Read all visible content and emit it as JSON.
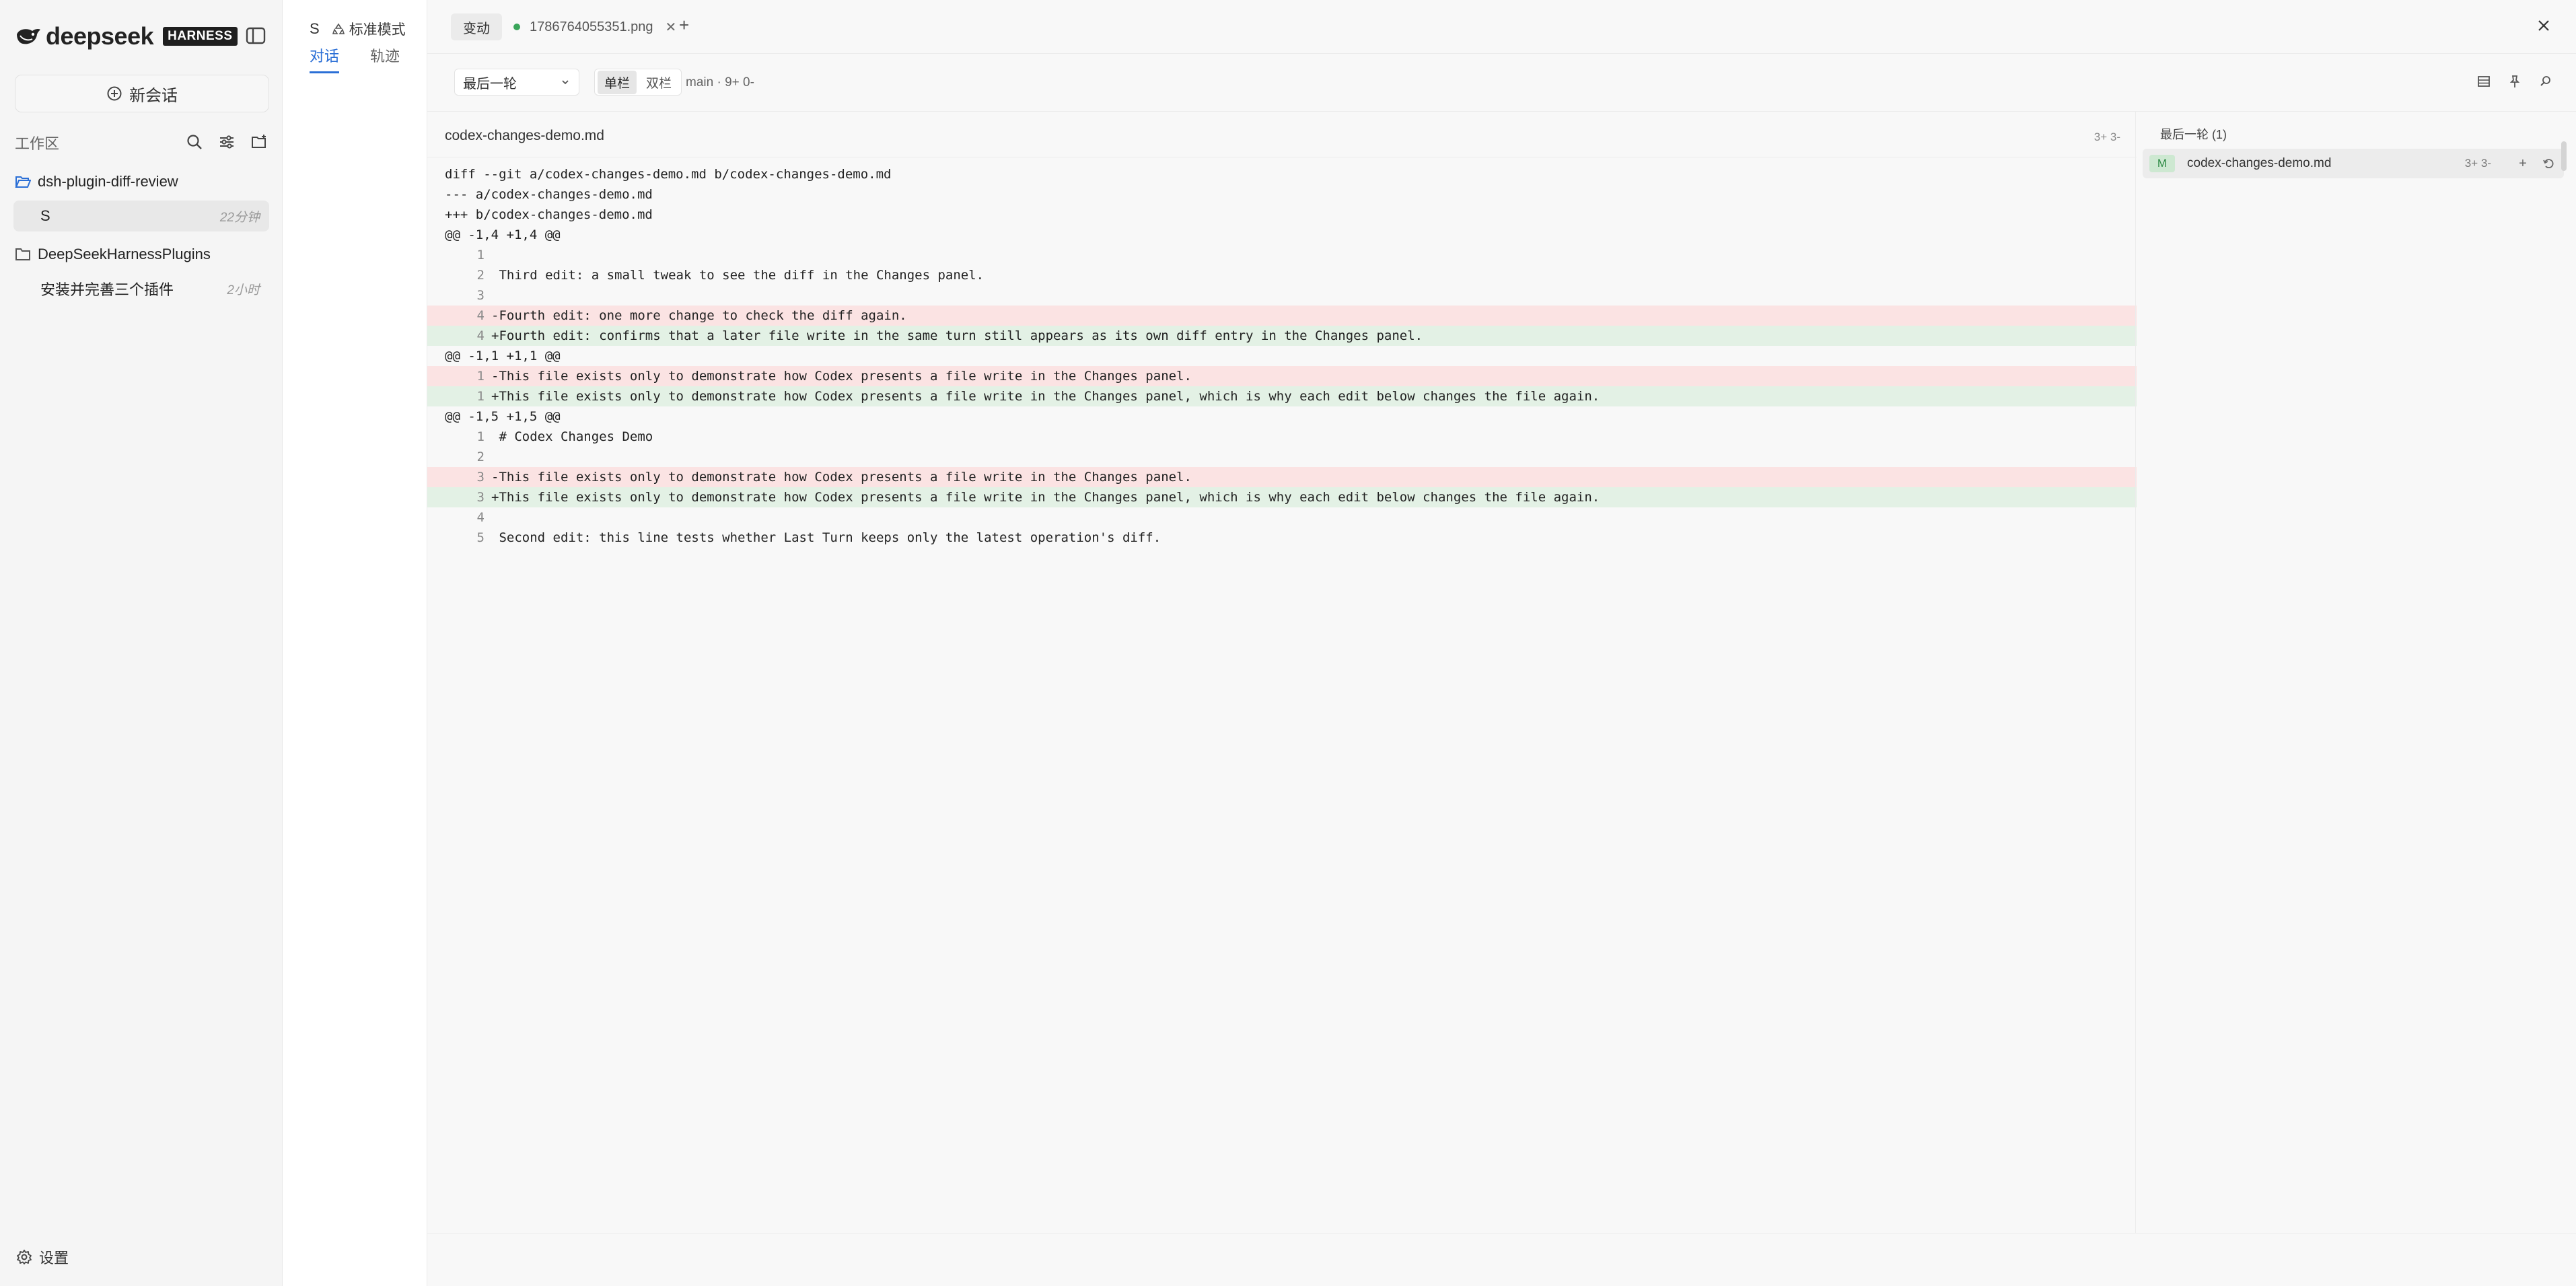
{
  "sidebar": {
    "brand": "deepseek",
    "badge": "HARNESS",
    "new_chat": "新会话",
    "workspace_label": "工作区",
    "projects": [
      {
        "name": "dsh-plugin-diff-review",
        "sessions": [
          {
            "name": "S",
            "time": "22分钟",
            "active": true
          }
        ]
      },
      {
        "name": "DeepSeekHarnessPlugins",
        "sessions": [
          {
            "name": "安装并完善三个插件",
            "time": "2小时",
            "active": false
          }
        ]
      }
    ],
    "settings": "设置"
  },
  "conversation": {
    "name": "S",
    "mode": "标准模式",
    "tabs": [
      "对话",
      "轨迹"
    ]
  },
  "main": {
    "tabs": {
      "changes": "变动",
      "file": "1786764055351.png"
    },
    "turn_select": "最后一轮",
    "view": {
      "unified": "单栏",
      "split": "双栏"
    },
    "branch": "main · 9+ 0-",
    "diff_file": "codex-changes-demo.md",
    "diff_stats": "3+ 3-",
    "diff_lines": [
      {
        "t": "meta",
        "n": "",
        "c": "diff --git a/codex-changes-demo.md b/codex-changes-demo.md"
      },
      {
        "t": "meta",
        "n": "",
        "c": "--- a/codex-changes-demo.md"
      },
      {
        "t": "meta",
        "n": "",
        "c": "+++ b/codex-changes-demo.md"
      },
      {
        "t": "meta",
        "n": "",
        "c": "@@ -1,4 +1,4 @@"
      },
      {
        "t": "ctx",
        "n": "1",
        "c": " "
      },
      {
        "t": "ctx",
        "n": "2",
        "c": " Third edit: a small tweak to see the diff in the Changes panel."
      },
      {
        "t": "ctx",
        "n": "3",
        "c": " "
      },
      {
        "t": "del",
        "n": "4",
        "c": "-Fourth edit: one more change to check the diff again."
      },
      {
        "t": "add",
        "n": "4",
        "c": "+Fourth edit: confirms that a later file write in the same turn still appears as its own diff entry in the Changes panel."
      },
      {
        "t": "meta",
        "n": "",
        "c": "@@ -1,1 +1,1 @@"
      },
      {
        "t": "del",
        "n": "1",
        "c": "-This file exists only to demonstrate how Codex presents a file write in the Changes panel."
      },
      {
        "t": "add",
        "n": "1",
        "c": "+This file exists only to demonstrate how Codex presents a file write in the Changes panel, which is why each edit below changes the file again."
      },
      {
        "t": "meta",
        "n": "",
        "c": "@@ -1,5 +1,5 @@"
      },
      {
        "t": "ctx",
        "n": "1",
        "c": " # Codex Changes Demo"
      },
      {
        "t": "ctx",
        "n": "2",
        "c": " "
      },
      {
        "t": "del",
        "n": "3",
        "c": "-This file exists only to demonstrate how Codex presents a file write in the Changes panel."
      },
      {
        "t": "add",
        "n": "3",
        "c": "+This file exists only to demonstrate how Codex presents a file write in the Changes panel, which is why each edit below changes the file again."
      },
      {
        "t": "ctx",
        "n": "4",
        "c": " "
      },
      {
        "t": "ctx",
        "n": "5",
        "c": " Second edit: this line tests whether Last Turn keeps only the latest operation's diff."
      }
    ],
    "right_panel": {
      "title": "最后一轮 (1)",
      "file": {
        "status": "M",
        "name": "codex-changes-demo.md",
        "stats": "3+ 3-"
      }
    }
  },
  "colors": {
    "accent": "#2b6fd6",
    "added_bg": "#e3f1e5",
    "removed_bg": "#fbe3e3",
    "modified_badge": "#2f8b46"
  },
  "icons": [
    "whale-logo-icon",
    "sidebar-toggle-icon",
    "plus-circle-icon",
    "search-icon",
    "filter-icon",
    "new-folder-icon",
    "folder-open-icon",
    "folder-icon",
    "gear-icon",
    "recycle-icon",
    "close-icon",
    "plus-icon",
    "chevron-down-icon",
    "table-icon",
    "pin-icon",
    "search-icon",
    "revert-icon"
  ]
}
